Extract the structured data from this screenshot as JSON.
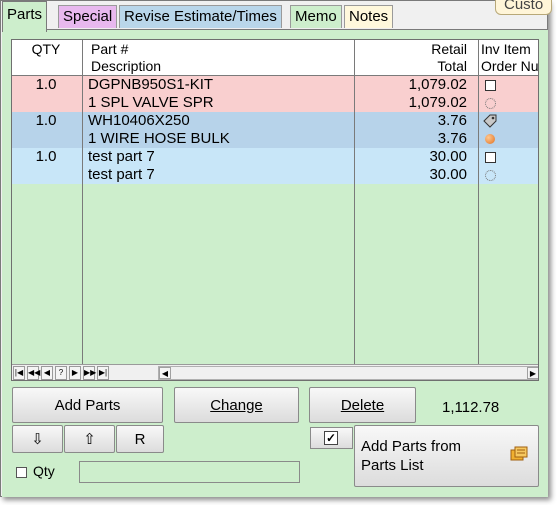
{
  "tabs": [
    {
      "label": "Parts"
    },
    {
      "label": "Special"
    },
    {
      "label": "Revise Estimate/Times"
    },
    {
      "label": "Memo"
    },
    {
      "label": "Notes"
    },
    {
      "label": "Custo"
    }
  ],
  "grid": {
    "headers": {
      "qty": "QTY",
      "part_line1": "Part #",
      "part_line2": "Description",
      "total_line1": "Retail",
      "total_line2": "Total",
      "inv_line1": "Inv Item",
      "inv_line2": "Order Nu"
    },
    "rows": [
      {
        "qty": "1.0",
        "part": "DGPNB950S1-KIT",
        "desc": "1 SPL VALVE SPR",
        "retail": "1,079.02",
        "total": "1,079.02",
        "inv_icon": "checkbox-icon",
        "order_icon": "dotted-circle-icon"
      },
      {
        "qty": "1.0",
        "part": "WH10406X250",
        "desc": "1 WIRE HOSE BULK",
        "retail": "3.76",
        "total": "3.76",
        "inv_icon": "tag-icon",
        "order_icon": "orange-dot-icon"
      },
      {
        "qty": "1.0",
        "part": "test part 7",
        "desc": "test part 7",
        "retail": "30.00",
        "total": "30.00",
        "inv_icon": "checkbox-icon",
        "order_icon": "dotted-circle-icon"
      }
    ],
    "nav_buttons": [
      "|◀",
      "◀◀",
      "◀",
      "?",
      "▶",
      "▶▶",
      "▶|"
    ]
  },
  "buttons": {
    "add_parts": "Add Parts",
    "change": "Change",
    "delete": "Delete",
    "move_down": "⇩",
    "move_up": "⇧",
    "r": "R",
    "add_from_list_line1": "Add Parts from",
    "add_from_list_line2": "Parts List"
  },
  "summary_total": "1,112.78",
  "qty_label": "Qty",
  "colors": {
    "panel": "#cdeecc",
    "row_red": "#f9cfcf",
    "row_blue": "#b7d3ea",
    "row_lightblue": "#c8e6f8"
  }
}
